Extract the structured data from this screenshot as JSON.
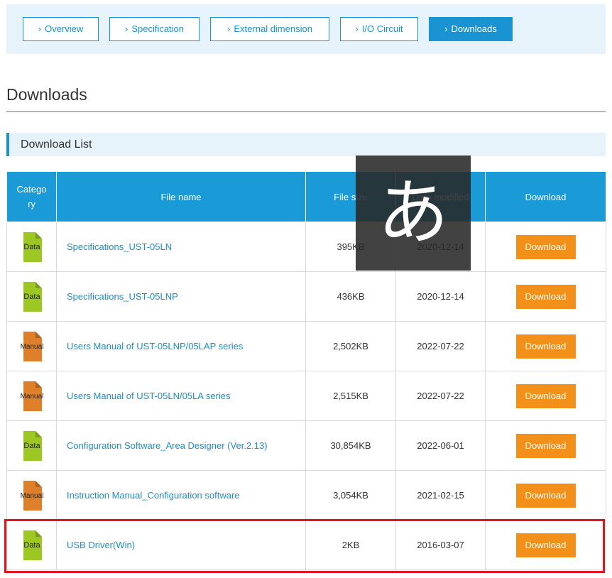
{
  "tabs": [
    {
      "label": "Overview",
      "active": false
    },
    {
      "label": "Specification",
      "active": false
    },
    {
      "label": "External dimension",
      "active": false
    },
    {
      "label": "I/O Circuit",
      "active": false
    },
    {
      "label": "Downloads",
      "active": true
    }
  ],
  "page_title": "Downloads",
  "section_title": "Download List",
  "table": {
    "headers": {
      "category_line1": "Catego",
      "category_line2": "ry",
      "file_name": "File name",
      "file_size": "File size",
      "date_modified": "Date modified",
      "download": "Download"
    },
    "rows": [
      {
        "category": "Data",
        "file_name": "Specifications_UST-05LN",
        "file_size": "395KB",
        "date": "2020-12-14",
        "button": "Download"
      },
      {
        "category": "Data",
        "file_name": "Specifications_UST-05LNP",
        "file_size": "436KB",
        "date": "2020-12-14",
        "button": "Download"
      },
      {
        "category": "Manual",
        "file_name": "Users Manual of UST-05LNP/05LAP series",
        "file_size": "2,502KB",
        "date": "2022-07-22",
        "button": "Download"
      },
      {
        "category": "Manual",
        "file_name": "Users Manual of UST-05LN/05LA series",
        "file_size": "2,515KB",
        "date": "2022-07-22",
        "button": "Download"
      },
      {
        "category": "Data",
        "file_name": "Configuration Software_Area Designer (Ver.2.13)",
        "file_size": "30,854KB",
        "date": "2022-06-01",
        "button": "Download"
      },
      {
        "category": "Manual",
        "file_name": "Instruction Manual_Configuration software",
        "file_size": "3,054KB",
        "date": "2021-02-15",
        "button": "Download"
      },
      {
        "category": "Data",
        "file_name": "USB Driver(Win)",
        "file_size": "2KB",
        "date": "2016-03-07",
        "button": "Download"
      }
    ]
  },
  "ime_indicator": "あ",
  "colors": {
    "accent": "#1a93d2",
    "header_bg": "#1a9ad6",
    "download_button": "#f39019",
    "data_icon": "#9dc823",
    "manual_icon": "#de7f2a",
    "highlight_border": "#e4141e"
  }
}
